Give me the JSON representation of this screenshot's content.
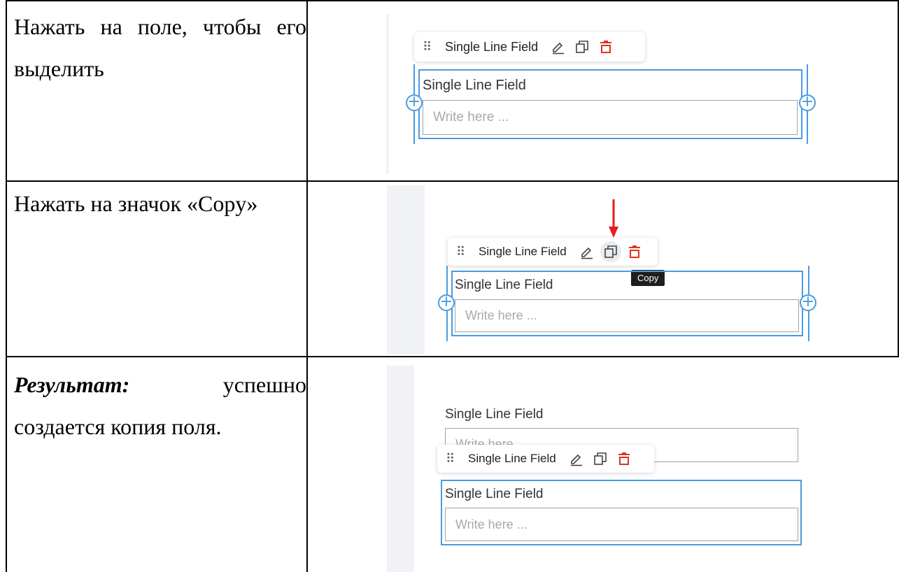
{
  "steps": [
    {
      "instruction": "Нажать на поле, чтобы его выделить",
      "screenshot": {
        "toolbar_label": "Single Line Field",
        "field_label": "Single Line Field",
        "placeholder": "Write here ..."
      }
    },
    {
      "instruction": "Нажать на значок «Copy»",
      "screenshot": {
        "toolbar_label": "Single Line Field",
        "field_label": "Single Line Field",
        "placeholder": "Write here ...",
        "tooltip": "Copy"
      }
    },
    {
      "result_label": "Результат:",
      "instruction_rest": "успешно создается копия поля.",
      "screenshot": {
        "original_field_label": "Single Line Field",
        "original_placeholder": "Write here",
        "toolbar_label": "Single Line Field",
        "field_label": "Single Line Field",
        "placeholder": "Write here ..."
      }
    }
  ],
  "colors": {
    "selection": "#4a9be2",
    "delete_icon": "#e0321e",
    "arrow": "#e81e1e"
  },
  "icons": [
    "drag-handle-icon",
    "edit-pencil-icon",
    "copy-icon",
    "delete-trash-icon",
    "add-plus-icon",
    "red-arrow-icon"
  ]
}
